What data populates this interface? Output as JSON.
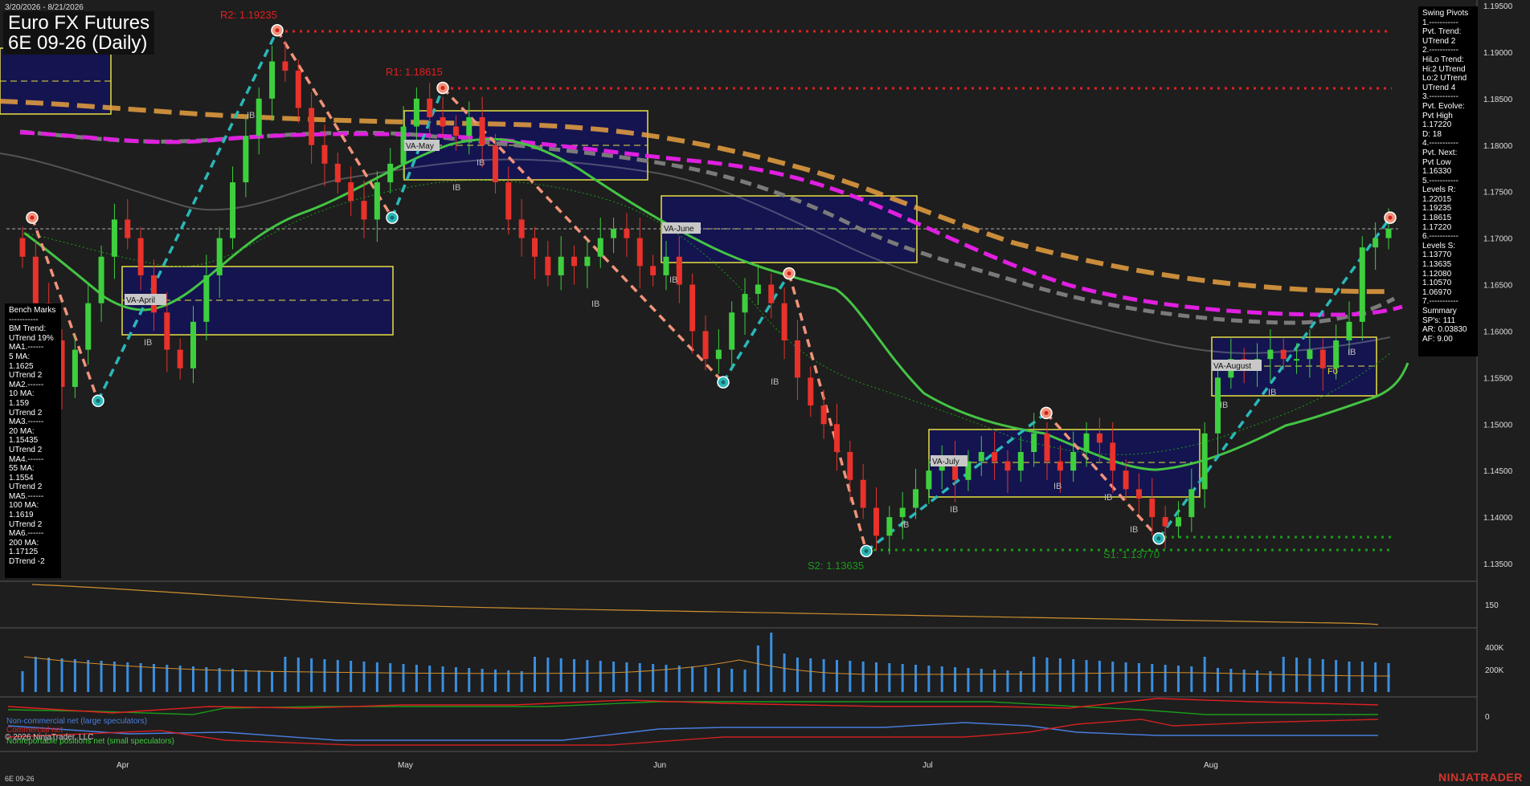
{
  "header": {
    "date_range": "3/20/2026 - 8/21/2026",
    "title": "Euro FX Futures",
    "subtitle": "6E 09-26 (Daily)"
  },
  "colors": {
    "background": "#1e1e1e",
    "up_candle": "#3ecf3e",
    "down_candle": "#e8322b",
    "ma_green": "#44c444",
    "ma_gray": "#6a6a6a",
    "ma_magenta": "#e020e0",
    "ma_orange": "#e0a030",
    "swing_up": "#2ab8b8",
    "swing_down": "#f0937a",
    "resistance": "#e02020",
    "support": "#1a9a1a",
    "value_box_fill": "#141450",
    "value_box_border": "#e8e040",
    "volume": "#3a8ee0",
    "brand": "#d4352b"
  },
  "price_axis": {
    "ticks": [
      "1.19500",
      "1.19000",
      "1.18500",
      "1.18000",
      "1.17500",
      "1.17000",
      "1.16500",
      "1.16000",
      "1.15500",
      "1.15000",
      "1.14500",
      "1.14000",
      "1.13500"
    ]
  },
  "time_axis": {
    "labels": [
      "Apr",
      "May",
      "Jun",
      "Jul",
      "Aug"
    ]
  },
  "levels": {
    "r2_label": "R2: 1.19235",
    "r1_label": "R1: 1.18615",
    "s2_label": "S2: 1.13635",
    "s1_label": "S1: 1.13770"
  },
  "value_areas": {
    "april": "VA-April",
    "may": "VA-May",
    "june": "VA-June",
    "july": "VA-July",
    "august": "VA-August"
  },
  "marker_labels": {
    "ib": "IB",
    "fo": "F0"
  },
  "bench_marks": {
    "lines": [
      "Bench Marks",
      "-----------",
      "BM Trend:",
      "UTrend 19%",
      "MA1.------",
      "5 MA:",
      "1.1625",
      "UTrend 2",
      "MA2.------",
      "10 MA:",
      "1.159",
      "UTrend 2",
      "MA3.------",
      "20 MA:",
      "1.15435",
      "UTrend 2",
      "MA4.------",
      "55 MA:",
      "1.1554",
      "UTrend 2",
      "MA5.------",
      "100 MA:",
      "1.1619",
      "UTrend 2",
      "MA6.------",
      "200 MA:",
      "1.17125",
      "DTrend -2"
    ]
  },
  "swing_pivots": {
    "lines": [
      "Swing Pivots",
      "1.-----------",
      "Pvt. Trend:",
      "UTrend 2",
      "2.-----------",
      "HiLo Trend:",
      "Hi:2 UTrend",
      "Lo:2 UTrend",
      "UTrend 4",
      "3.-----------",
      "Pvt. Evolve:",
      "Pvt High",
      "1.17220",
      "D: 18",
      "4.-----------",
      "Pvt. Next:",
      "Pvt Low",
      "1.16330",
      "5.-----------",
      "Levels R:",
      "1.22015",
      "1.19235",
      "1.18615",
      "1.17220",
      "6.-----------",
      "Levels S:",
      "1.13770",
      "1.13635",
      "1.12080",
      "1.10570",
      "1.06970",
      "7.-----------",
      "Summary",
      "SP's: 111",
      "AR: 0.03830",
      "AF: 9.00"
    ]
  },
  "sub_panels": {
    "adx_tick": "150",
    "volume_ticks": [
      "400K",
      "200K"
    ],
    "cot_tick": "0"
  },
  "legend": {
    "noncommercial": "Non-commercial net (large speculators)",
    "commercial": "Commercial net",
    "nonreportable": "Nonreportable positions net (small speculators)"
  },
  "footer": {
    "copyright": "© 2026 NinjaTrader, LLC",
    "symbol": "6E 09-26",
    "brand": "NINJATRADER"
  },
  "chart_data": {
    "type": "candlestick",
    "title": "Euro FX Futures",
    "subtitle": "6E 09-26 (Daily)",
    "ylim": [
      1.1325,
      1.1955
    ],
    "y_ticks": [
      1.195,
      1.19,
      1.185,
      1.18,
      1.175,
      1.17,
      1.165,
      1.16,
      1.155,
      1.15,
      1.145,
      1.14,
      1.135
    ],
    "x_labels": [
      "Apr",
      "May",
      "Jun",
      "Jul",
      "Aug"
    ],
    "grid": false,
    "horizontal_levels": [
      {
        "label": "R2",
        "value": 1.19235
      },
      {
        "label": "R1",
        "value": 1.18615
      },
      {
        "label": "S2",
        "value": 1.13635
      },
      {
        "label": "S1",
        "value": 1.1377
      }
    ],
    "swing_pivots": [
      {
        "type": "high",
        "value": 1.1722
      },
      {
        "type": "low",
        "value": 1.1525
      },
      {
        "type": "high",
        "value": 1.19235
      },
      {
        "type": "low",
        "value": 1.1722
      },
      {
        "type": "high",
        "value": 1.18615
      },
      {
        "type": "low",
        "value": 1.1545
      },
      {
        "type": "high",
        "value": 1.1662
      },
      {
        "type": "low",
        "value": 1.13635
      },
      {
        "type": "high",
        "value": 1.1512
      },
      {
        "type": "low",
        "value": 1.1377
      },
      {
        "type": "high",
        "value": 1.1722
      }
    ],
    "closes": [
      1.168,
      1.163,
      1.159,
      1.154,
      1.158,
      1.163,
      1.168,
      1.172,
      1.17,
      1.166,
      1.162,
      1.158,
      1.156,
      1.161,
      1.166,
      1.17,
      1.176,
      1.181,
      1.185,
      1.189,
      1.188,
      1.184,
      1.18,
      1.178,
      1.176,
      1.174,
      1.172,
      1.176,
      1.178,
      1.182,
      1.185,
      1.183,
      1.182,
      1.181,
      1.183,
      1.18,
      1.176,
      1.172,
      1.17,
      1.168,
      1.166,
      1.168,
      1.167,
      1.168,
      1.17,
      1.171,
      1.17,
      1.167,
      1.166,
      1.168,
      1.165,
      1.16,
      1.157,
      1.158,
      1.162,
      1.164,
      1.165,
      1.163,
      1.159,
      1.155,
      1.152,
      1.15,
      1.147,
      1.144,
      1.141,
      1.138,
      1.14,
      1.141,
      1.143,
      1.145,
      1.146,
      1.144,
      1.146,
      1.147,
      1.146,
      1.145,
      1.147,
      1.149,
      1.146,
      1.145,
      1.147,
      1.149,
      1.148,
      1.145,
      1.143,
      1.142,
      1.14,
      1.139,
      1.14,
      1.143,
      1.149,
      1.155,
      1.157,
      1.156,
      1.157,
      1.158,
      1.157,
      1.157,
      1.158,
      1.156,
      1.159,
      1.161,
      1.169,
      1.17,
      1.171
    ],
    "moving_averages": [
      {
        "name": "5 MA",
        "value": 1.1625
      },
      {
        "name": "10 MA",
        "value": 1.159
      },
      {
        "name": "20 MA",
        "value": 1.15435
      },
      {
        "name": "55 MA",
        "value": 1.1554
      },
      {
        "name": "100 MA",
        "value": 1.1619
      },
      {
        "name": "200 MA",
        "value": 1.17125
      }
    ],
    "value_areas": [
      {
        "name": "VA-April",
        "high": 1.167,
        "low": 1.1595,
        "mid": 1.1633
      },
      {
        "name": "VA-May",
        "high": 1.1837,
        "low": 1.1762,
        "mid": 1.18
      },
      {
        "name": "VA-June",
        "high": 1.1747,
        "low": 1.1675,
        "mid": 1.1711
      },
      {
        "name": "VA-July",
        "high": 1.1495,
        "low": 1.1423,
        "mid": 1.1459
      },
      {
        "name": "VA-August",
        "high": 1.1592,
        "low": 1.1528,
        "mid": 1.1562
      }
    ]
  }
}
